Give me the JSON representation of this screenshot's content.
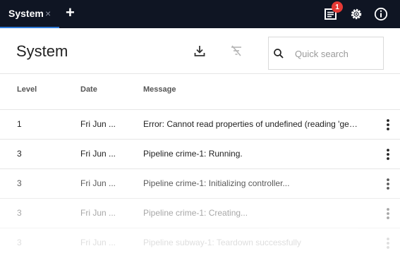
{
  "tabs": [
    {
      "label": "System",
      "close_glyph": "×"
    }
  ],
  "add_tab_glyph": "+",
  "notifications": {
    "count": "1"
  },
  "header": {
    "title": "System"
  },
  "search": {
    "placeholder": "Quick search"
  },
  "table": {
    "columns": [
      "Level",
      "Date",
      "Message"
    ],
    "rows": [
      {
        "level": "1",
        "date": "Fri Jun ...",
        "message": "Error: Cannot read properties of undefined (reading 'getB...",
        "opacity": 1.0
      },
      {
        "level": "3",
        "date": "Fri Jun ...",
        "message": "Pipeline crime-1: Running.",
        "opacity": 1.0
      },
      {
        "level": "3",
        "date": "Fri Jun ...",
        "message": "Pipeline crime-1: Initializing controller...",
        "opacity": 0.75
      },
      {
        "level": "3",
        "date": "Fri Jun ...",
        "message": "Pipeline crime-1: Creating...",
        "opacity": 0.4
      },
      {
        "level": "3",
        "date": "Fri Jun ...",
        "message": "Pipeline subway-1: Teardown successfully",
        "opacity": 0.15
      }
    ]
  },
  "icons": {
    "tab_close": "close-icon",
    "add_tab": "plus-icon",
    "notifications": "list-icon",
    "settings": "gear-icon",
    "info": "info-icon",
    "download": "download-icon",
    "clear_filter": "filter-off-icon",
    "search": "search-icon",
    "row_menu": "more-vertical-icon"
  },
  "colors": {
    "topbar": "#0f1523",
    "tab_indicator": "#2f7bd8",
    "badge": "#e53935"
  }
}
